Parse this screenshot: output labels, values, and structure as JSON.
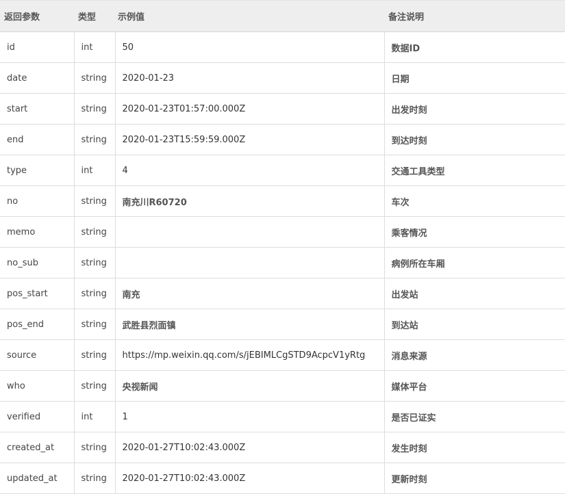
{
  "header": {
    "param": "返回参数",
    "type": "类型",
    "example": "示例值",
    "note": "备注说明"
  },
  "rows": [
    {
      "param": "id",
      "type": "int",
      "example": "50",
      "note": "数据ID"
    },
    {
      "param": "date",
      "type": "string",
      "example": "2020-01-23",
      "note": "日期"
    },
    {
      "param": "start",
      "type": "string",
      "example": "2020-01-23T01:57:00.000Z",
      "note": "出发时刻"
    },
    {
      "param": "end",
      "type": "string",
      "example": "2020-01-23T15:59:59.000Z",
      "note": "到达时刻"
    },
    {
      "param": "type",
      "type": "int",
      "example": "4",
      "note": "交通工具类型"
    },
    {
      "param": "no",
      "type": "string",
      "example": "南充川R60720",
      "note": "车次"
    },
    {
      "param": "memo",
      "type": "string",
      "example": "",
      "note": "乘客情况"
    },
    {
      "param": "no_sub",
      "type": "string",
      "example": "",
      "note": "病例所在车厢"
    },
    {
      "param": "pos_start",
      "type": "string",
      "example": "南充",
      "note": "出发站"
    },
    {
      "param": "pos_end",
      "type": "string",
      "example": "武胜县烈面镇",
      "note": "到达站"
    },
    {
      "param": "source",
      "type": "string",
      "example": "https://mp.weixin.qq.com/s/jEBIMLCgSTD9AcpcV1yRtg",
      "note": "消息来源"
    },
    {
      "param": "who",
      "type": "string",
      "example": "央视新闻",
      "note": "媒体平台"
    },
    {
      "param": "verified",
      "type": "int",
      "example": "1",
      "note": "是否已证实"
    },
    {
      "param": "created_at",
      "type": "string",
      "example": "2020-01-27T10:02:43.000Z",
      "note": "发生时刻"
    },
    {
      "param": "updated_at",
      "type": "string",
      "example": "2020-01-27T10:02:43.000Z",
      "note": "更新时刻"
    }
  ]
}
